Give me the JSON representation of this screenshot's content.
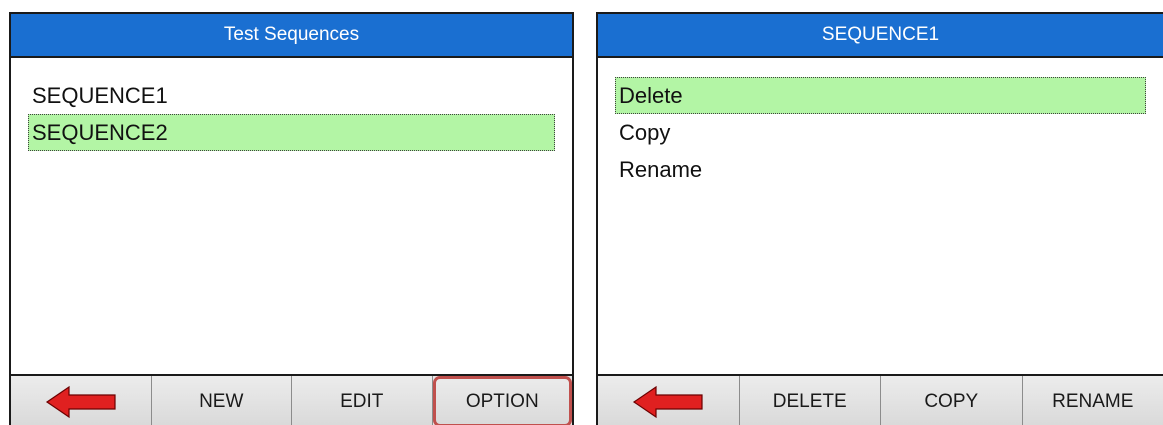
{
  "left_screen": {
    "title": "Test Sequences",
    "items": [
      {
        "label": "SEQUENCE1",
        "selected": false
      },
      {
        "label": "SEQUENCE2",
        "selected": true
      }
    ],
    "toolbar": {
      "back_icon": "red-left-arrow-icon",
      "new_label": "NEW",
      "edit_label": "EDIT",
      "option_label": "OPTION"
    }
  },
  "right_screen": {
    "title": "SEQUENCE1",
    "items": [
      {
        "label": "Delete",
        "selected": true
      },
      {
        "label": "Copy",
        "selected": false
      },
      {
        "label": "Rename",
        "selected": false
      }
    ],
    "toolbar": {
      "back_icon": "red-left-arrow-icon",
      "delete_label": "DELETE",
      "copy_label": "COPY",
      "rename_label": "RENAME"
    }
  },
  "colors": {
    "titlebar": "#1a6fd1",
    "selection": "#b3f5a5",
    "arrow": "#e02020",
    "option_highlight": "#c0504d"
  }
}
